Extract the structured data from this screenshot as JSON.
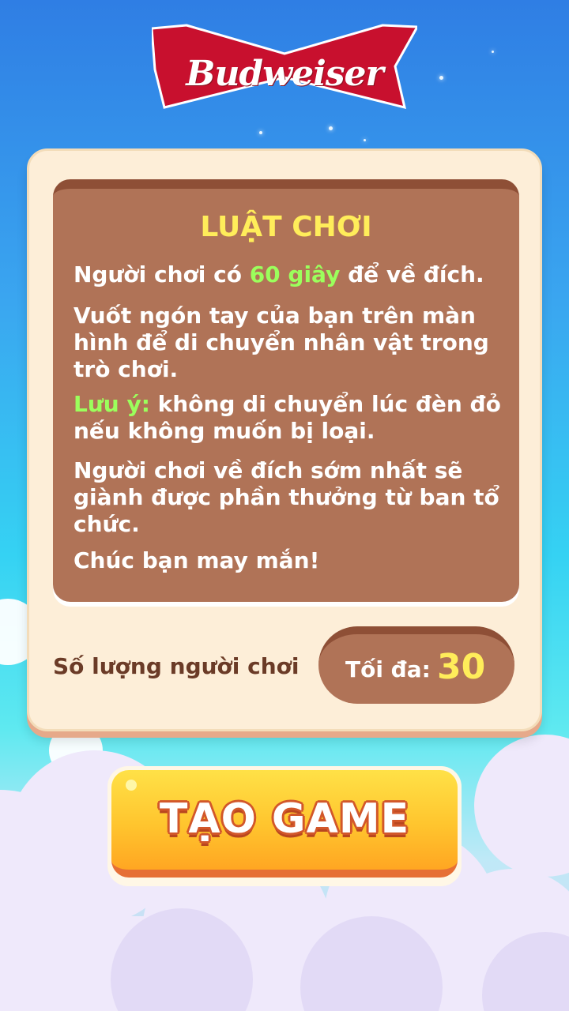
{
  "brand": {
    "logo_text": "Budweiser"
  },
  "rules": {
    "title": "LUẬT CHƠI",
    "rule1_before": "Người chơi có ",
    "rule1_highlight": "60 giây",
    "rule1_after": " để về đích.",
    "rule2": "Vuốt ngón tay của bạn trên màn hình để di chuyển nhân vật trong trò chơi.",
    "rule3_highlight": "Lưu ý:",
    "rule3_after": " không di chuyển lúc đèn đỏ nếu không muốn bị loại.",
    "rule4": "Người chơi về đích sớm nhất sẽ giành được phần thưởng từ ban tổ chức.",
    "rule5": "Chúc bạn may mắn!"
  },
  "players": {
    "label": "Số lượng người chơi",
    "max_label": "Tối đa:",
    "max_value": "30"
  },
  "create_button": {
    "label": "TẠO GAME"
  },
  "colors": {
    "brand_red": "#c8102e",
    "panel_bg": "#fdeed8",
    "rules_bg": "#b07357",
    "title_yellow": "#ffed5a",
    "highlight_green": "#9bff5c",
    "button_yellow": "#ffc52e"
  }
}
